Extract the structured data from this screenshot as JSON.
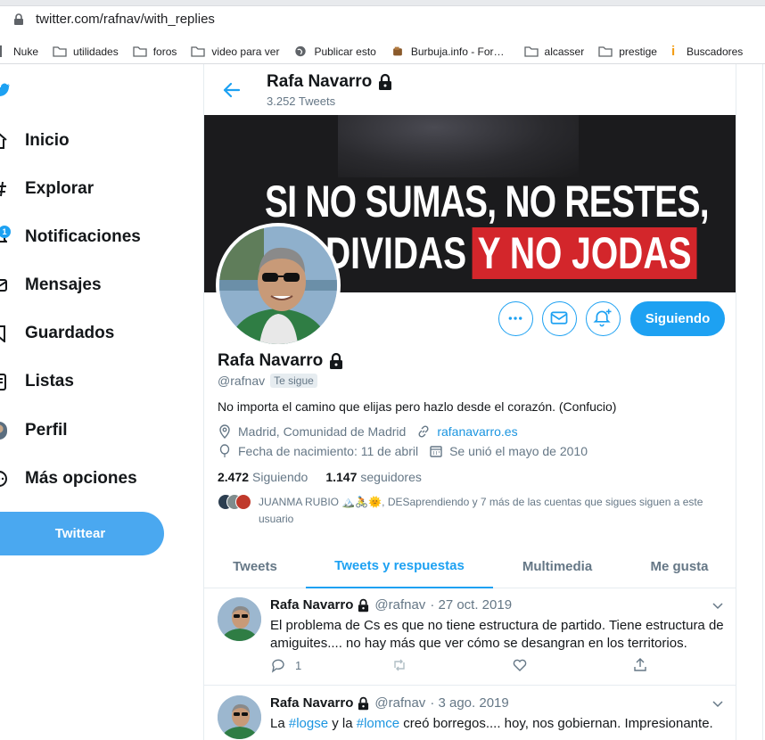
{
  "browser": {
    "url": "twitter.com/rafnav/with_replies",
    "bookmarks": [
      "Nuke",
      "utilidades",
      "foros",
      "video para ver",
      "Publicar esto",
      "Burbuja.info - For…",
      "alcasser",
      "prestige",
      "Buscadores"
    ]
  },
  "sidebar": {
    "items": [
      {
        "label": "Inicio",
        "icon": "home-icon"
      },
      {
        "label": "Explorar",
        "icon": "hashtag-icon"
      },
      {
        "label": "Notificaciones",
        "icon": "bell-icon",
        "badge": "1"
      },
      {
        "label": "Mensajes",
        "icon": "mail-icon"
      },
      {
        "label": "Guardados",
        "icon": "bookmark-icon"
      },
      {
        "label": "Listas",
        "icon": "list-icon"
      },
      {
        "label": "Perfil",
        "icon": "profile-icon"
      },
      {
        "label": "Más opciones",
        "icon": "more-circle-icon"
      }
    ],
    "tweet_button": "Twittear"
  },
  "header": {
    "name": "Rafa Navarro",
    "tweet_count": "3.252 Tweets"
  },
  "banner": {
    "line1": "SI NO SUMAS, NO RESTES,",
    "line2a": "DIVIDAS",
    "line2b": "Y NO JODAS"
  },
  "profile": {
    "name": "Rafa Navarro",
    "handle": "@rafnav",
    "follows_you": "Te sigue",
    "bio": "No importa el camino que elijas pero hazlo desde el corazón. (Confucio)",
    "location": "Madrid, Comunidad de Madrid",
    "website": "rafanavarro.es",
    "birth": "Fecha de nacimiento: 11 de abril",
    "joined": "Se unió el mayo de 2010",
    "following_count": "2.472",
    "following_label": "Siguiendo",
    "followers_count": "1.147",
    "followers_label": "seguidores",
    "followed_by": "JUANMA RUBIO 🏔️🚴🌞, DESaprendiendo y 7 más de las cuentas que sigues siguen a este usuario",
    "following_button": "Siguiendo"
  },
  "tabs": [
    "Tweets",
    "Tweets y respuestas",
    "Multimedia",
    "Me gusta"
  ],
  "tweets": [
    {
      "name": "Rafa Navarro",
      "handle": "@rafnav",
      "date": "· 27 oct. 2019",
      "text": "El problema de Cs es que no tiene estructura de partido. Tiene estructura de amiguites.... no hay más que ver cómo se desangran en los territorios.",
      "replies": "1"
    },
    {
      "name": "Rafa Navarro",
      "handle": "@rafnav",
      "date": "· 3 ago. 2019",
      "text_parts": [
        "La ",
        "#logse",
        " y la ",
        "#lomce",
        " creó borregos.... hoy, nos gobiernan. Impresionante."
      ]
    }
  ],
  "colors": {
    "accent": "#1da1f2",
    "banner_red": "#d3262b",
    "muted": "#657786"
  }
}
